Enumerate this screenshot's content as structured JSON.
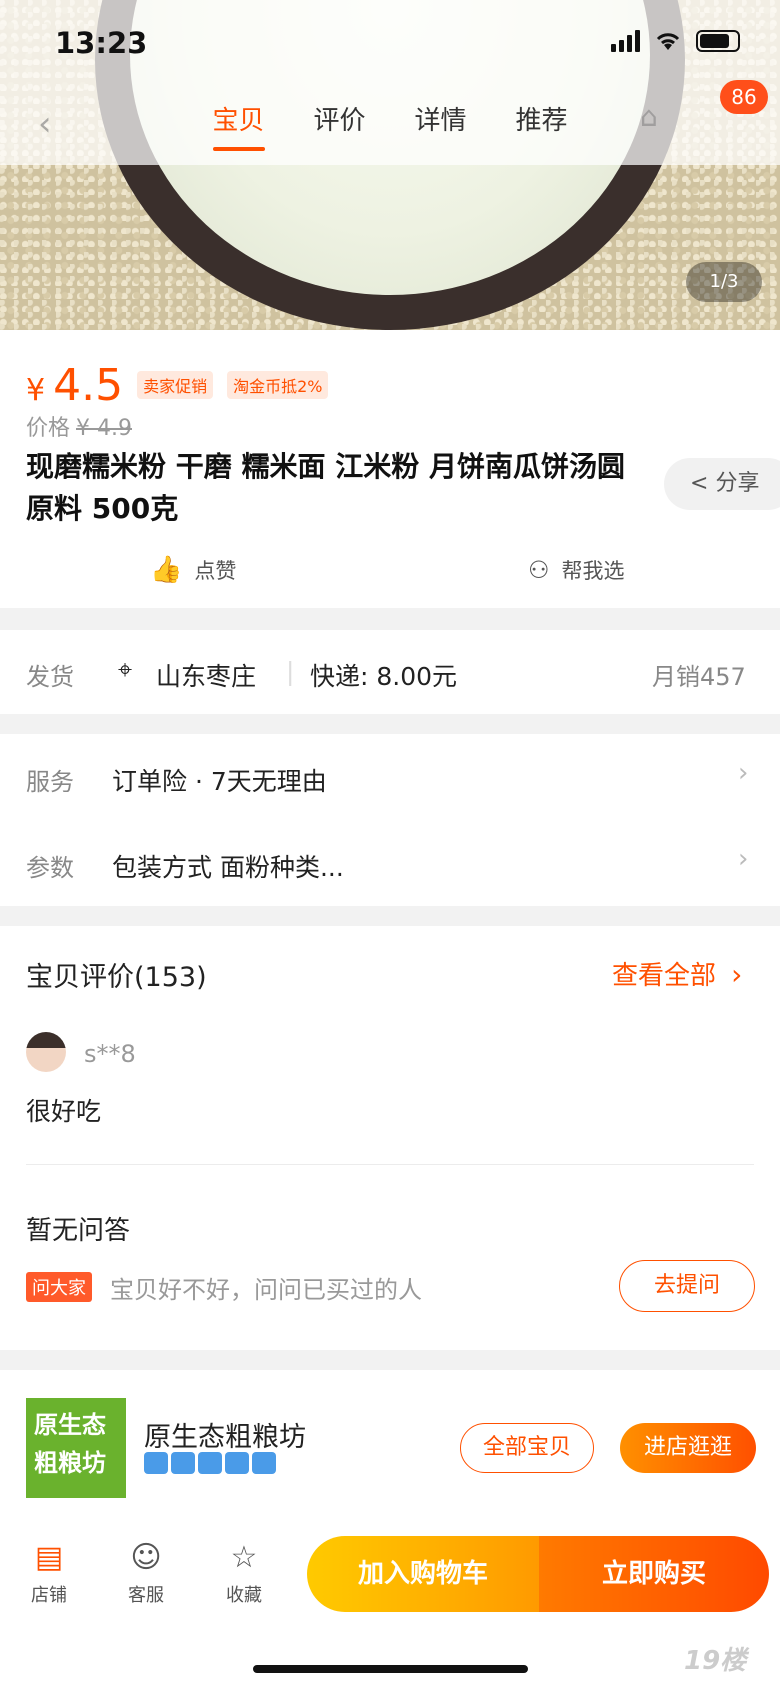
{
  "status": {
    "time": "13:23",
    "badge_count": "86"
  },
  "tabs": [
    {
      "label": "宝贝",
      "active": true
    },
    {
      "label": "评价",
      "active": false
    },
    {
      "label": "详情",
      "active": false
    },
    {
      "label": "推荐",
      "active": false
    }
  ],
  "gallery": {
    "pager": "1/3"
  },
  "product": {
    "currency": "¥",
    "price": "4.5",
    "tags": [
      "卖家促销",
      "淘金币抵2%"
    ],
    "orig_label": "价格",
    "orig_price": "¥ 4.9",
    "title": "现磨糯米粉 干磨 糯米面 江米粉 月饼南瓜饼汤圆原料 500克",
    "share": "分享",
    "like": "点赞",
    "help_choose": "帮我选"
  },
  "shipping": {
    "label": "发货",
    "location": "山东枣庄",
    "express": "快递: 8.00元",
    "monthly_sales": "月销457"
  },
  "service": {
    "label": "服务",
    "value": "订单险 · 7天无理由"
  },
  "params": {
    "label": "参数",
    "value": "包装方式 面粉种类..."
  },
  "reviews": {
    "title": "宝贝评价(153)",
    "view_all": "查看全部",
    "user": "s**8",
    "text": "很好吃"
  },
  "qa": {
    "title": "暂无问答",
    "tag": "问大家",
    "hint": "宝贝好不好，问问已买过的人",
    "ask_button": "去提问"
  },
  "shop": {
    "logo_text": "原生态粗粮坊",
    "name": "原生态粗粮坊",
    "all_items": "全部宝贝",
    "enter_shop": "进店逛逛"
  },
  "bottom": {
    "store": "店铺",
    "service": "客服",
    "favorite": "收藏",
    "add_cart": "加入购物车",
    "buy_now": "立即购买"
  },
  "watermark": "19楼",
  "colors": {
    "accent": "#ff5000"
  }
}
